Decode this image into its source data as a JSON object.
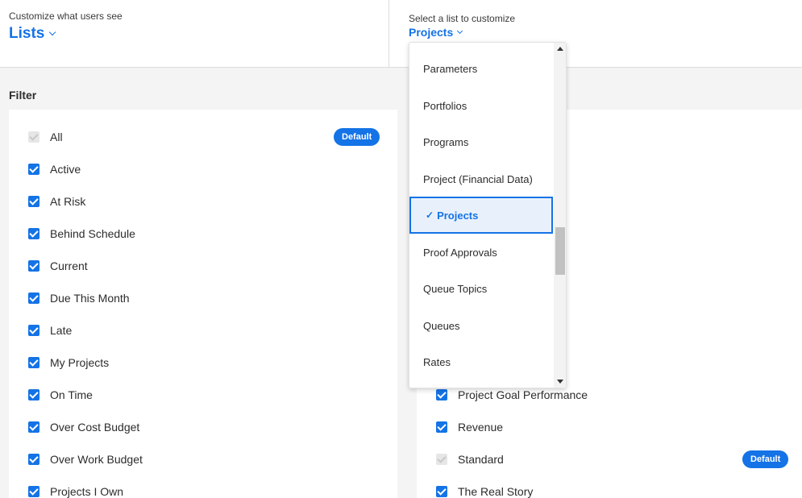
{
  "header": {
    "left_caption": "Customize what users see",
    "left_title": "Lists",
    "right_caption": "Select a list to customize",
    "right_title": "Projects"
  },
  "filter_label": "Filter",
  "left_list": [
    {
      "label": "All",
      "checked": true,
      "disabled": true,
      "badge": "Default"
    },
    {
      "label": "Active",
      "checked": true
    },
    {
      "label": "At Risk",
      "checked": true
    },
    {
      "label": "Behind Schedule",
      "checked": true
    },
    {
      "label": "Current",
      "checked": true
    },
    {
      "label": "Due This Month",
      "checked": true
    },
    {
      "label": "Late",
      "checked": true
    },
    {
      "label": "My Projects",
      "checked": true
    },
    {
      "label": "On Time",
      "checked": true
    },
    {
      "label": "Over Cost Budget",
      "checked": true
    },
    {
      "label": "Over Work Budget",
      "checked": true
    },
    {
      "label": "Projects I Own",
      "checked": true
    }
  ],
  "right_list": [
    {
      "label": "Project Goal Performance",
      "checked": true
    },
    {
      "label": "Revenue",
      "checked": true
    },
    {
      "label": "Standard",
      "checked": true,
      "disabled": true,
      "badge": "Default"
    },
    {
      "label": "The Real Story",
      "checked": true
    }
  ],
  "dropdown": {
    "items": [
      "Parameters",
      "Portfolios",
      "Programs",
      "Project (Financial Data)",
      "Projects",
      "Proof Approvals",
      "Queue Topics",
      "Queues",
      "Rates"
    ],
    "selected": "Projects",
    "check_glyph": "✓"
  },
  "colors": {
    "accent": "#1473e6",
    "selected_bg": "#e8f1fb"
  },
  "icons": [
    "chevron-down-icon",
    "checkmark-icon",
    "scroll-up-arrow-icon",
    "scroll-down-arrow-icon"
  ]
}
